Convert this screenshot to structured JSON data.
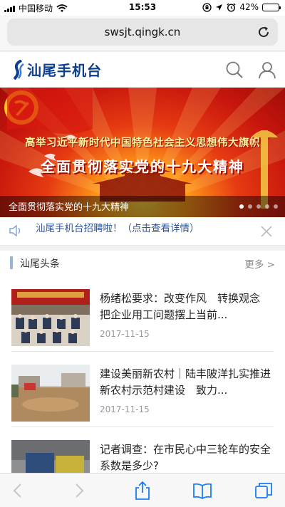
{
  "status_bar": {
    "carrier": "中国移动",
    "time": "15:53",
    "battery": "42%",
    "battery_level": 0.42
  },
  "browser": {
    "url": "swsjt.qingk.cn"
  },
  "site": {
    "name": "汕尾手机台"
  },
  "banner": {
    "slogan_line1": "高举习近平新时代中国特色社会主义思想伟大旗帜",
    "slogan_line2": "全面贯彻落实党的十九大精神",
    "caption": "全面贯彻落实党的十九大精神",
    "dot_count": 5,
    "active_dot": 1
  },
  "notice": {
    "text": "汕尾手机台招聘啦！（点击查看详情）"
  },
  "section": {
    "title": "汕尾头条",
    "more": "更多 >"
  },
  "news": [
    {
      "title": "杨绪松要求：改变作风　转换观念　把企业用工问题摆上当前...",
      "date": "2017-11-15"
    },
    {
      "title": "建设美丽新农村｜陆丰陂洋扎实推进新农村示范村建设　致力...",
      "date": "2017-11-15"
    },
    {
      "title": "记者调查：在市民心中三轮车的安全系数是多少?",
      "date": ""
    }
  ],
  "colors": {
    "logo_blue": "#0d3f8f",
    "notice_blue": "#2b55a0",
    "banner_red": "#c8160d",
    "battery_yellow": "#f5c400"
  }
}
